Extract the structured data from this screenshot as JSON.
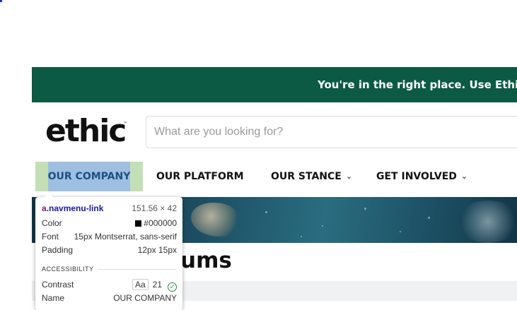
{
  "banner": {
    "text": "You're in the right place. Use Ethic to"
  },
  "header": {
    "logo": "ethic",
    "logo_tm": "™",
    "search_placeholder": "What are you looking for?"
  },
  "nav": {
    "items": [
      {
        "label": "OUR COMPANY"
      },
      {
        "label": "OUR PLATFORM"
      },
      {
        "label": "OUR STANCE",
        "chevron": "⌄"
      },
      {
        "label": "GET INVOLVED",
        "chevron": "⌄"
      }
    ]
  },
  "section": {
    "heading_partial": "ums"
  },
  "inspector": {
    "selector_tag": "a",
    "selector_class": ".navmenu-link",
    "dimensions": "151.56 × 42",
    "color_label": "Color",
    "color_value": "#000000",
    "font_label": "Font",
    "font_value": "15px Montserrat, sans-serif",
    "padding_label": "Padding",
    "padding_value": "12px 15px",
    "accessibility_title": "ACCESSIBILITY",
    "contrast_label": "Contrast",
    "contrast_badge": "Aa",
    "contrast_value": "21",
    "name_label": "Name",
    "name_value": "OUR COMPANY"
  },
  "colors": {
    "banner_bg": "#0c5a43",
    "highlight_bg": "#c3dfb5",
    "text_selection": "#9fbfe0"
  }
}
